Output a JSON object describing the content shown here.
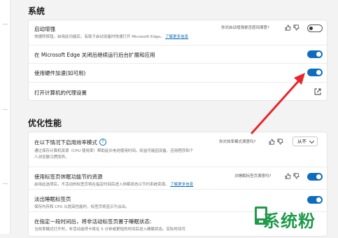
{
  "system": {
    "heading": "系统",
    "startup_boost": {
      "title": "启动增强",
      "desc": "快捷转按钮。启用此功能后，有助于启动设备时快速打开 Microsoft Edge。",
      "link": "了解更多信息",
      "feedback": "你对启动增强是否感到满意?",
      "toggle": "off"
    },
    "background_apps": {
      "title": "在 Microsoft Edge 关闭后继续运行后台扩展和应用",
      "toggle": "on"
    },
    "hardware_accel": {
      "title": "使用硬件加速(如可用)",
      "toggle": "on"
    },
    "proxy": {
      "title": "打开计算机的代理设置"
    }
  },
  "performance": {
    "heading": "优化性能",
    "efficiency_mode": {
      "title": "在以下情况下启用效率模式",
      "desc_line1": "通过保存计算机资源（CPU 使用率）帮助延长电池使用时间。权益可能因设备、应用程序和个",
      "desc_line2": "人浏览器习惯而异。",
      "feedback": "你对效率模式满意吗?",
      "select_value": "从不"
    },
    "sleeping_tabs": {
      "title": "使用标签页休眠功能节约资源",
      "desc": "启用此选项后，不活动的标签页将在指定时间后进入休眠状态以节约系统资源。",
      "link": "了解更多信息",
      "feedback": "对睡眠标签页满意吗?",
      "toggle": "on"
    },
    "fade_tabs": {
      "title": "淡出睡眠标签页",
      "desc": "保存内存和 CPU 以提高性能时，标签页将显示为淡出。",
      "toggle": "on"
    },
    "sleep_after": {
      "title": "在指定一段时间后，将非活动标签页置于睡眠状态:",
      "desc": "当效率模式打开时，非活动选项卡将在 5 分钟或更短的时间后进入睡眠状态。实际时间可"
    }
  },
  "watermark": {
    "text": "系统粉"
  },
  "colors": {
    "accent": "#0f6cbd",
    "arrow": "#e8262c",
    "logo": "#1e9a4a"
  }
}
